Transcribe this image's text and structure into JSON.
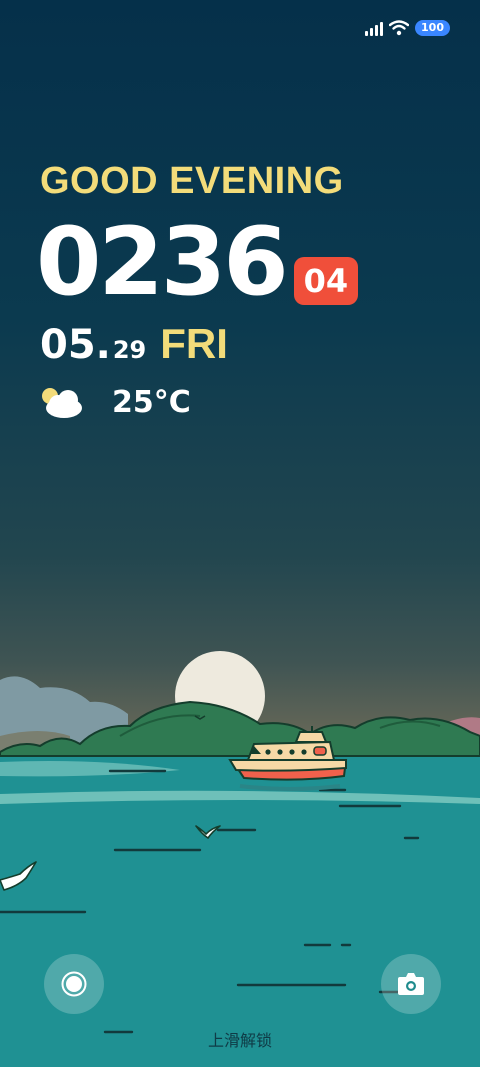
{
  "status_bar": {
    "signal_icon": "signal-bars-icon",
    "wifi_icon": "wifi-icon",
    "battery_level": "100"
  },
  "lock": {
    "greeting": "GOOD EVENING",
    "time": "0236",
    "seconds": "04",
    "date_main": "05.",
    "date_day": "29",
    "weekday": "FRI",
    "weather_icon": "partly-cloudy-icon",
    "temperature": "25°C"
  },
  "bottom": {
    "left_shortcut_icon": "record-icon",
    "right_shortcut_icon": "camera-icon",
    "unlock_hint": "上滑解锁"
  },
  "colors": {
    "greeting": "#f3dc7a",
    "seconds_badge": "#f04f3a",
    "battery_badge": "#3a86ff"
  }
}
